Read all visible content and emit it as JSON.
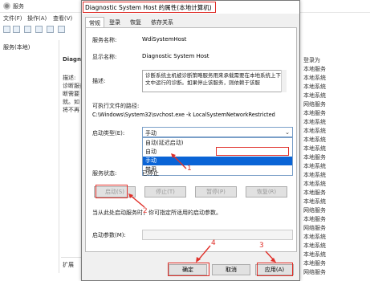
{
  "background_window": {
    "title": "服务",
    "menu": [
      "文件(F)",
      "操作(A)",
      "查看(V)"
    ],
    "tree_item": "服务(本地)",
    "left_header": "Diagnc",
    "left_side_texts": [
      "描述:",
      "诊断服务",
      "断需要",
      "就。如",
      "将不再"
    ],
    "bottom_tab": "扩展",
    "right_column_header": "登录为",
    "right_column": [
      "本地服务",
      "本地系统",
      "本地系统",
      "本地系统",
      "网络服务",
      "本地服务",
      "本地系统",
      "本地系统",
      "本地系统",
      "本地系统",
      "本地服务",
      "本地系统",
      "本地系统",
      "本地系统",
      "本地服务",
      "本地系统",
      "网络服务",
      "本地服务",
      "网络服务",
      "本地系统",
      "本地系统",
      "本地系统",
      "本地服务",
      "网络服务"
    ]
  },
  "dialog": {
    "title": "Diagnostic System Host 的属性(本地计算机)",
    "tabs": [
      "常规",
      "登录",
      "恢复",
      "依存关系"
    ],
    "service_name_label": "服务名称:",
    "service_name": "WdiSystemHost",
    "display_name_label": "显示名称:",
    "display_name": "Diagnostic System Host",
    "description_label": "描述:",
    "description": "诊断系统主机被诊断策略服务用来承载需要在本地系统上下文中运行的诊断。如果停止该服务，则依赖于该服",
    "exe_path_label": "可执行文件的路径:",
    "exe_path": "C:\\Windows\\System32\\svchost.exe -k LocalSystemNetworkRestricted",
    "startup_type_label": "启动类型(E):",
    "startup_type_value": "手动",
    "startup_options": [
      "自动(延迟启动)",
      "自动",
      "手动",
      "禁用"
    ],
    "selected_option_index": 2,
    "service_status_label": "服务状态:",
    "service_status_value": "已停止",
    "buttons": {
      "start": "启动(S)",
      "stop": "停止(T)",
      "pause": "暂停(P)",
      "resume": "恢复(R)"
    },
    "hint": "当从此处启动服务时，你可指定所适用的启动参数。",
    "start_params_label": "启动参数(M):",
    "footer": {
      "ok": "确定",
      "cancel": "取消",
      "apply": "应用(A)"
    }
  },
  "annotations": [
    "1",
    "2",
    "3",
    "4"
  ],
  "colors": {
    "annotation_red": "#e0302a",
    "selection_blue": "#0a64d6"
  }
}
